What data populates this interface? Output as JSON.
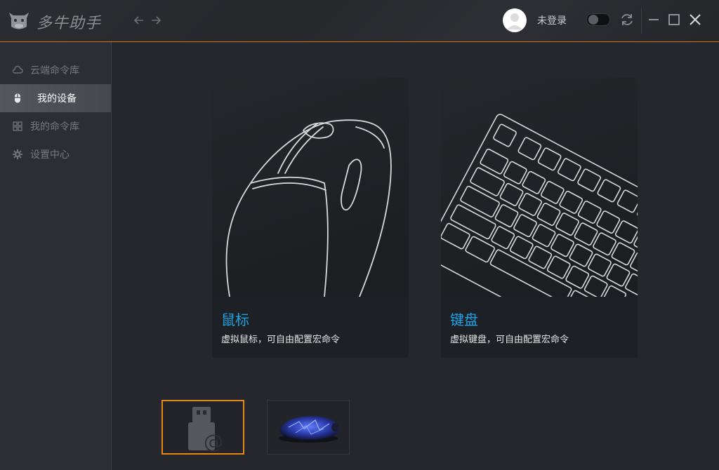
{
  "app": {
    "title": "多牛助手"
  },
  "header": {
    "login_status": "未登录"
  },
  "sidebar": {
    "items": [
      {
        "label": "云端命令库",
        "icon": "cloud-icon"
      },
      {
        "label": "我的设备",
        "icon": "mouse-icon",
        "active": true
      },
      {
        "label": "我的命令库",
        "icon": "grid-icon"
      },
      {
        "label": "设置中心",
        "icon": "gear-icon"
      }
    ]
  },
  "cards": [
    {
      "title": "鼠标",
      "desc": "虚拟鼠标，可自由配置宏命令"
    },
    {
      "title": "键盘",
      "desc": "虚拟键盘，可自由配置宏命令"
    }
  ],
  "devices": [
    {
      "icon": "usb-device-icon",
      "selected": true
    },
    {
      "icon": "gaming-mouse-icon",
      "selected": false
    }
  ],
  "colors": {
    "accent_orange": "#e38a16",
    "title_blue": "#1fa3e6",
    "background": "#25272c"
  }
}
